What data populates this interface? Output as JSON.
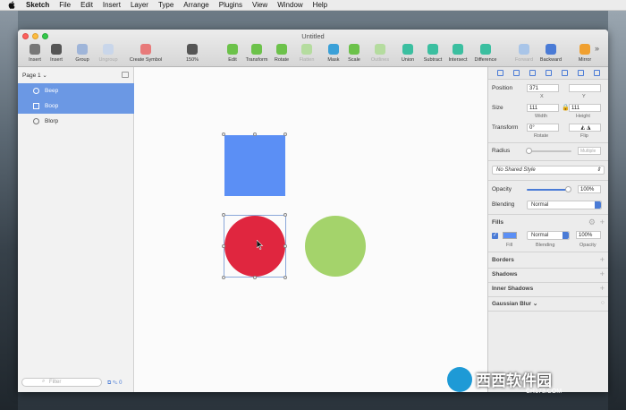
{
  "menubar": {
    "app": "Sketch",
    "items": [
      "File",
      "Edit",
      "Insert",
      "Layer",
      "Type",
      "Arrange",
      "Plugins",
      "View",
      "Window",
      "Help"
    ]
  },
  "window": {
    "title": "Untitled"
  },
  "toolbar": {
    "items": [
      {
        "label": "Insert",
        "icon": "plus-icon",
        "color": "#777777"
      },
      {
        "label": "Insert",
        "icon": "shape-icon",
        "color": "#555555"
      },
      {
        "label": "Group",
        "icon": "group-icon",
        "color": "#9fb5d9"
      },
      {
        "label": "Ungroup",
        "icon": "ungroup-icon",
        "color": "#c9d6ea"
      },
      {
        "label": "Create Symbol",
        "icon": "symbol-icon",
        "color": "#e87a7a"
      },
      {
        "label": "150%",
        "icon": "zoom-icon",
        "color": "#555555"
      },
      {
        "label": "Edit",
        "icon": "edit-icon",
        "color": "#6cc24a"
      },
      {
        "label": "Transform",
        "icon": "transform-icon",
        "color": "#6cc24a"
      },
      {
        "label": "Rotate",
        "icon": "rotate-icon",
        "color": "#6cc24a"
      },
      {
        "label": "Flatten",
        "icon": "flatten-icon",
        "color": "#b5dc9f"
      },
      {
        "label": "Mask",
        "icon": "mask-icon",
        "color": "#3aa0d8"
      },
      {
        "label": "Scale",
        "icon": "scale-icon",
        "color": "#6cc24a"
      },
      {
        "label": "Outlines",
        "icon": "outlines-icon",
        "color": "#b5dc9f"
      },
      {
        "label": "Union",
        "icon": "union-icon",
        "color": "#3bbfa0"
      },
      {
        "label": "Subtract",
        "icon": "subtract-icon",
        "color": "#3bbfa0"
      },
      {
        "label": "Intersect",
        "icon": "intersect-icon",
        "color": "#3bbfa0"
      },
      {
        "label": "Difference",
        "icon": "difference-icon",
        "color": "#3bbfa0"
      },
      {
        "label": "Forward",
        "icon": "forward-icon",
        "color": "#a9c5e8"
      },
      {
        "label": "Backward",
        "icon": "backward-icon",
        "color": "#4a7bd6"
      },
      {
        "label": "Mirror",
        "icon": "mirror-icon",
        "color": "#f0a030"
      }
    ]
  },
  "sidebar": {
    "page": "Page 1",
    "layers": [
      {
        "name": "Beep",
        "shape": "circle",
        "selected": true
      },
      {
        "name": "Boop",
        "shape": "square",
        "selected": true
      },
      {
        "name": "Blorp",
        "shape": "circle",
        "selected": false
      }
    ],
    "filter_placeholder": "Filter",
    "filter_count": "0"
  },
  "canvas": {
    "shapes": [
      {
        "name": "Boop",
        "type": "square",
        "color": "#5b8ff5"
      },
      {
        "name": "Beep",
        "type": "circle",
        "color": "#e0263f"
      },
      {
        "name": "Blorp",
        "type": "circle",
        "color": "#a4d36b"
      }
    ]
  },
  "inspector": {
    "position": {
      "label": "Position",
      "x": "371",
      "y": "",
      "x_label": "X",
      "y_label": "Y"
    },
    "size": {
      "label": "Size",
      "width": "111",
      "height": "111",
      "width_label": "Width",
      "height_label": "Height"
    },
    "transform": {
      "label": "Transform",
      "rotate": "0°",
      "rotate_label": "Rotate",
      "flip_label": "Flip"
    },
    "radius": {
      "label": "Radius",
      "value": "Multiple"
    },
    "shared_style": "No Shared Style",
    "opacity": {
      "label": "Opacity",
      "value": "100%"
    },
    "blending": {
      "label": "Blending",
      "value": "Normal"
    },
    "fills": {
      "label": "Fills",
      "blending": "Normal",
      "opacity": "100%",
      "fill_label": "Fill",
      "blending_label": "Blending",
      "opacity_label": "Opacity",
      "color": "#5b8ff5"
    },
    "sections": [
      "Borders",
      "Shadows",
      "Inner Shadows",
      "Gaussian Blur"
    ]
  },
  "watermark": {
    "text": "西西软件园",
    "url": "CR173.COM"
  }
}
